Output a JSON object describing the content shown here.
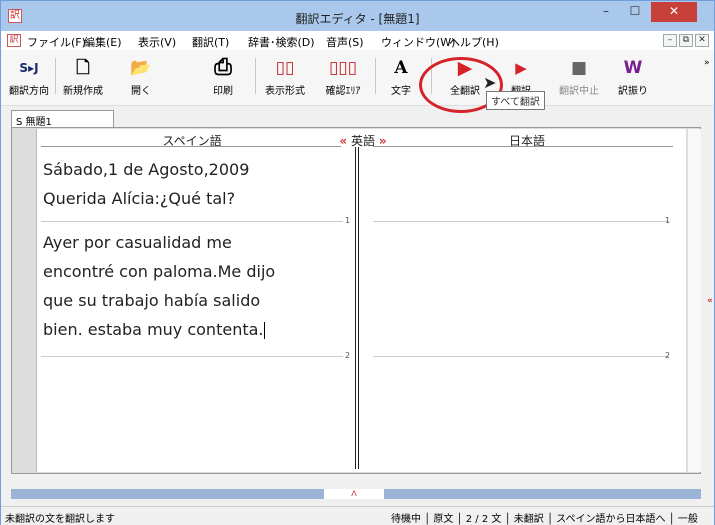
{
  "window": {
    "title": "翻訳エディタ - [無題1]",
    "app_icon": "訳",
    "minimize": "–",
    "maximize": "☐",
    "close": "✕"
  },
  "menubar": {
    "doc_icon": "訳",
    "items": [
      "ファイル(F)",
      "編集(E)",
      "表示(V)",
      "翻訳(T)",
      "辞書･検索(D)",
      "音声(S)",
      "ウィンドウ(W)",
      "ヘルプ(H)"
    ],
    "mdi_minimize": "–",
    "mdi_restore": "⧉",
    "mdi_close": "✕"
  },
  "toolbar": {
    "direction": {
      "glyph": "S▸J",
      "label": "翻訳方向"
    },
    "new": {
      "glyph": "🗋",
      "label": "新規作成"
    },
    "open": {
      "glyph": "📂",
      "label": "開く"
    },
    "print": {
      "glyph": "⎙",
      "label": "印刷"
    },
    "view": {
      "glyph": "▯▯",
      "label": "表示形式"
    },
    "confirm": {
      "glyph": "▯▯▯",
      "label": "確認ｴﾘｱ"
    },
    "font": {
      "glyph": "A",
      "label": "文字"
    },
    "translate_all": {
      "glyph": "▶",
      "label": "全翻訳"
    },
    "translate_sentence": {
      "glyph": "▶",
      "label": "翻訳"
    },
    "stop": {
      "glyph": "■",
      "label": "翻訳中止"
    },
    "alternatives": {
      "glyph": "W",
      "label": "訳振り"
    },
    "more": "»",
    "tooltip": "すべて翻訳",
    "accent_color": "#d6232a"
  },
  "doc_tab": {
    "label": "S 無題1"
  },
  "editor": {
    "source_language": "スペイン語",
    "pivot_language": "英語",
    "target_language": "日本語",
    "chevron_left": "«",
    "chevron_right": "»",
    "paragraphs": [
      {
        "number": "1",
        "lines": [
          "Sábado,1 de Agosto,2009",
          "Querida Alícia:¿Qué tal?"
        ]
      },
      {
        "number": "2",
        "lines": [
          "Ayer por casualidad me",
          "encontré con paloma.Me dijo",
          "que su trabajo había salido",
          "bien. estaba muy contenta."
        ]
      }
    ]
  },
  "side_tab": "«",
  "splitter_grip": "ᐱ",
  "status": {
    "left": "未翻訳の文を翻訳します",
    "right": "待機中 │ 原文 │ 2 / 2 文 │ 未翻訳 │ スペイン語から日本語へ │ 一般"
  }
}
